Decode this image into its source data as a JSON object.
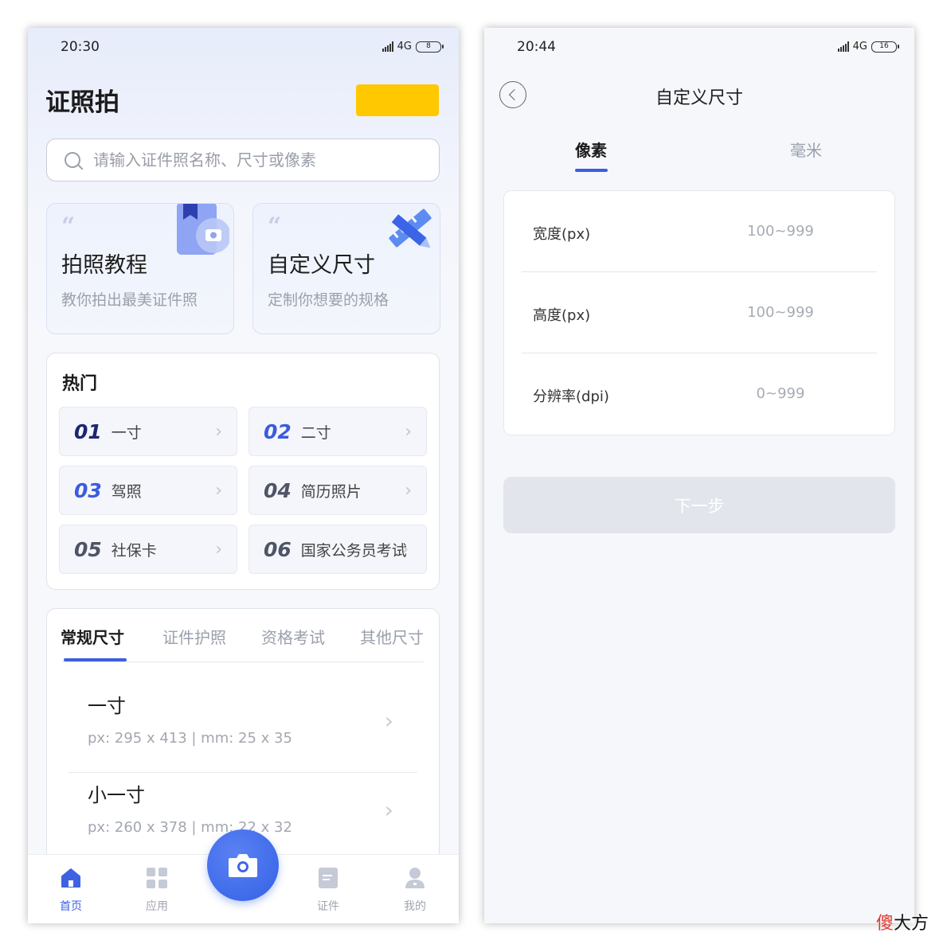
{
  "left_screen": {
    "status_bar": {
      "time": "20:30",
      "network": "4G",
      "battery": "8"
    },
    "app_title": "证照拍",
    "search": {
      "placeholder": "请输入证件照名称、尺寸或像素"
    },
    "feature_cards": [
      {
        "title": "拍照教程",
        "subtitle": "教你拍出最美证件照"
      },
      {
        "title": "自定义尺寸",
        "subtitle": "定制你想要的规格"
      }
    ],
    "hot": {
      "title": "热门",
      "items": [
        {
          "num": "01",
          "label": "一寸"
        },
        {
          "num": "02",
          "label": "二寸"
        },
        {
          "num": "03",
          "label": "驾照"
        },
        {
          "num": "04",
          "label": "简历照片"
        },
        {
          "num": "05",
          "label": "社保卡"
        },
        {
          "num": "06",
          "label": "国家公务员考试"
        }
      ]
    },
    "size_tabs": [
      "常规尺寸",
      "证件护照",
      "资格考试",
      "其他尺寸"
    ],
    "size_list": [
      {
        "name": "一寸",
        "detail": "px: 295 x 413 | mm: 25 x 35"
      },
      {
        "name": "小一寸",
        "detail": "px: 260 x 378 | mm: 22 x 32"
      }
    ],
    "bottom_nav": [
      {
        "label": "首页",
        "icon": "home-icon"
      },
      {
        "label": "应用",
        "icon": "apps-icon"
      },
      {
        "label": "证件",
        "icon": "document-icon"
      },
      {
        "label": "我的",
        "icon": "profile-icon"
      }
    ],
    "colors": {
      "accent": "#3d5fe0",
      "highlight_block": "#ffc800"
    }
  },
  "right_screen": {
    "status_bar": {
      "time": "20:44",
      "network": "4G",
      "battery": "16"
    },
    "title": "自定义尺寸",
    "unit_tabs": [
      "像素",
      "毫米"
    ],
    "fields": [
      {
        "label": "宽度(px)",
        "placeholder": "100~999"
      },
      {
        "label": "高度(px)",
        "placeholder": "100~999"
      },
      {
        "label": "分辨率(dpi)",
        "placeholder": "0~999"
      }
    ],
    "next_button": "下一步"
  },
  "watermark": {
    "first": "傻",
    "rest": "大方"
  }
}
